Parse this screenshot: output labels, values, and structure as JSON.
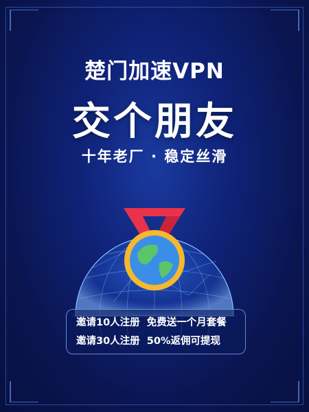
{
  "brand_title": "楚门加速VPN",
  "headline": "交个朋友",
  "tagline": "十年老厂 · 稳定丝滑",
  "offers": [
    {
      "condition": "邀请10人注册",
      "reward": "免费送一个月套餐"
    },
    {
      "condition": "邀请30人注册",
      "reward": "50%返佣可提现"
    }
  ],
  "icons": [
    "globe-network-icon",
    "medal-icon",
    "earth-icon"
  ],
  "colors": {
    "background": "#0a1550",
    "ribbon": "#e8334a",
    "medal_rim": "#f5b82e",
    "globe_glow": "#3f8cff"
  }
}
